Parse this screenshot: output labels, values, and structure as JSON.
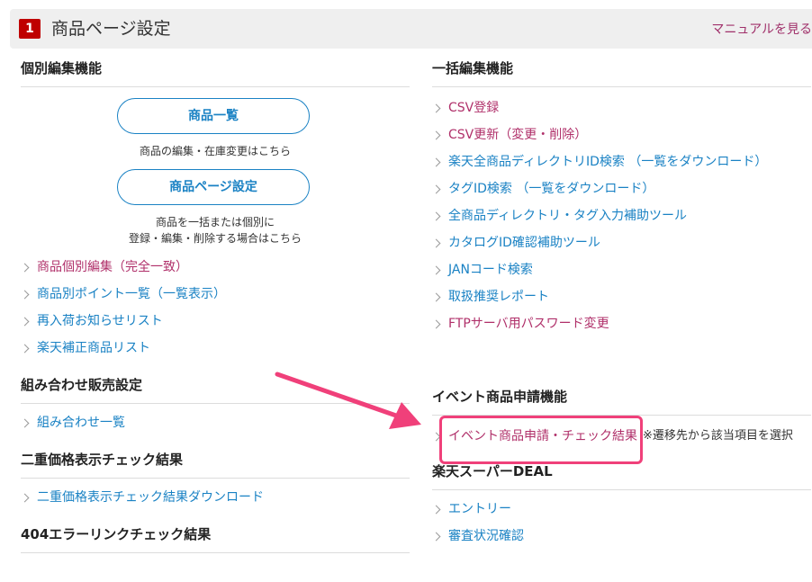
{
  "header": {
    "step_number": "1",
    "title": "商品ページ設定",
    "manual_link": "マニュアルを見る"
  },
  "individual_edit": {
    "title": "個別編集機能",
    "button_product_list": "商品一覧",
    "caption_product_list": "商品の編集・在庫変更はこちら",
    "button_product_page": "商品ページ設定",
    "caption_product_page_line1": "商品を一括または個別に",
    "caption_product_page_line2": "登録・編集・削除する場合はこちら",
    "links": [
      {
        "label": "商品個別編集（完全一致）"
      },
      {
        "label": "商品別ポイント一覧（一覧表示）"
      },
      {
        "label": "再入荷お知らせリスト"
      },
      {
        "label": "楽天補正商品リスト"
      }
    ]
  },
  "bulk_edit": {
    "title": "一括編集機能",
    "links": [
      {
        "label": "CSV登録"
      },
      {
        "label": "CSV更新（変更・削除）"
      },
      {
        "label": "楽天全商品ディレクトリID検索 （一覧をダウンロード）"
      },
      {
        "label": "タグID検索 （一覧をダウンロード）"
      },
      {
        "label": "全商品ディレクトリ・タグ入力補助ツール"
      },
      {
        "label": "カタログID確認補助ツール"
      },
      {
        "label": "JANコード検索"
      },
      {
        "label": "取扱推奨レポート"
      },
      {
        "label": "FTPサーバ用パスワード変更"
      }
    ]
  },
  "combo_sales": {
    "title": "組み合わせ販売設定",
    "links": [
      {
        "label": "組み合わせ一覧"
      }
    ]
  },
  "event_application": {
    "title": "イベント商品申請機能",
    "link": "イベント商品申請・チェック結果",
    "note": "※遷移先から該当項目を選択"
  },
  "double_price": {
    "title": "二重価格表示チェック結果",
    "links": [
      {
        "label": "二重価格表示チェック結果ダウンロード"
      }
    ]
  },
  "super_deal": {
    "title": "楽天スーパーDEAL",
    "links": [
      {
        "label": "エントリー"
      },
      {
        "label": "審査状況確認"
      }
    ]
  },
  "error_link": {
    "title": "404エラーリンクチェック結果"
  },
  "colors": {
    "accent_red": "#bf0000",
    "link_red": "#b0306a",
    "link_blue": "#1a82c4",
    "annotation_pink": "#f0407a"
  }
}
